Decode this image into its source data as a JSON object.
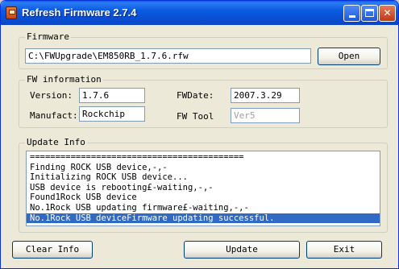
{
  "window": {
    "title": "Refresh Firmware 2.7.4",
    "title_buttons": {
      "minimize": "minimize",
      "maximize": "maximize",
      "close": "✕"
    }
  },
  "firmware_group": {
    "legend": "Firmware",
    "path_value": "C:\\FWUpgrade\\EM850RB_1.7.6.rfw",
    "open_label": "Open"
  },
  "fw_info_group": {
    "legend": "FW information",
    "version_label": "Version:",
    "version_value": "1.7.6",
    "fwdate_label": "FWDate:",
    "fwdate_value": "2007.3.29",
    "manufact_label": "Manufact:",
    "manufact_value": "Rockchip",
    "fwtool_label": "FW Tool",
    "fwtool_value": "Ver5"
  },
  "update_group": {
    "legend": "Update Info",
    "log_lines": [
      "==========================================",
      "Finding ROCK USB device,-,-",
      "Initializing ROCK USB device...",
      "USB device is rebooting£-waiting,-,-",
      "Found1Rock USB device",
      "No.1Rock USB updating firmware£-waiting,-,-",
      "No.1Rock USB deviceFirmware updating successful."
    ],
    "selected_index": 6
  },
  "bottom_buttons": {
    "clear_label": "Clear Info",
    "update_label": "Update",
    "exit_label": "Exit"
  },
  "colors": {
    "titlebar": "#0a5cdc",
    "window_bg": "#ece9d8",
    "selection": "#316ac5"
  }
}
